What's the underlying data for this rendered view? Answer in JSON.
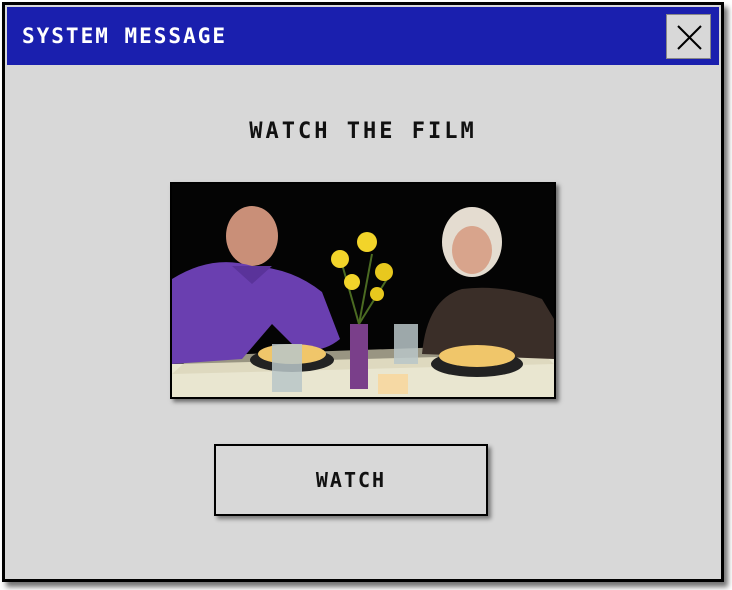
{
  "window": {
    "title": "SYSTEM MESSAGE",
    "close_icon": "close-icon"
  },
  "content": {
    "heading": "WATCH THE FILM",
    "thumbnail_subject": "video-thumbnail",
    "button_label": "WATCH"
  },
  "colors": {
    "titlebar": "#1a1fae",
    "window_bg": "#d8d8d8",
    "border": "#000000"
  }
}
